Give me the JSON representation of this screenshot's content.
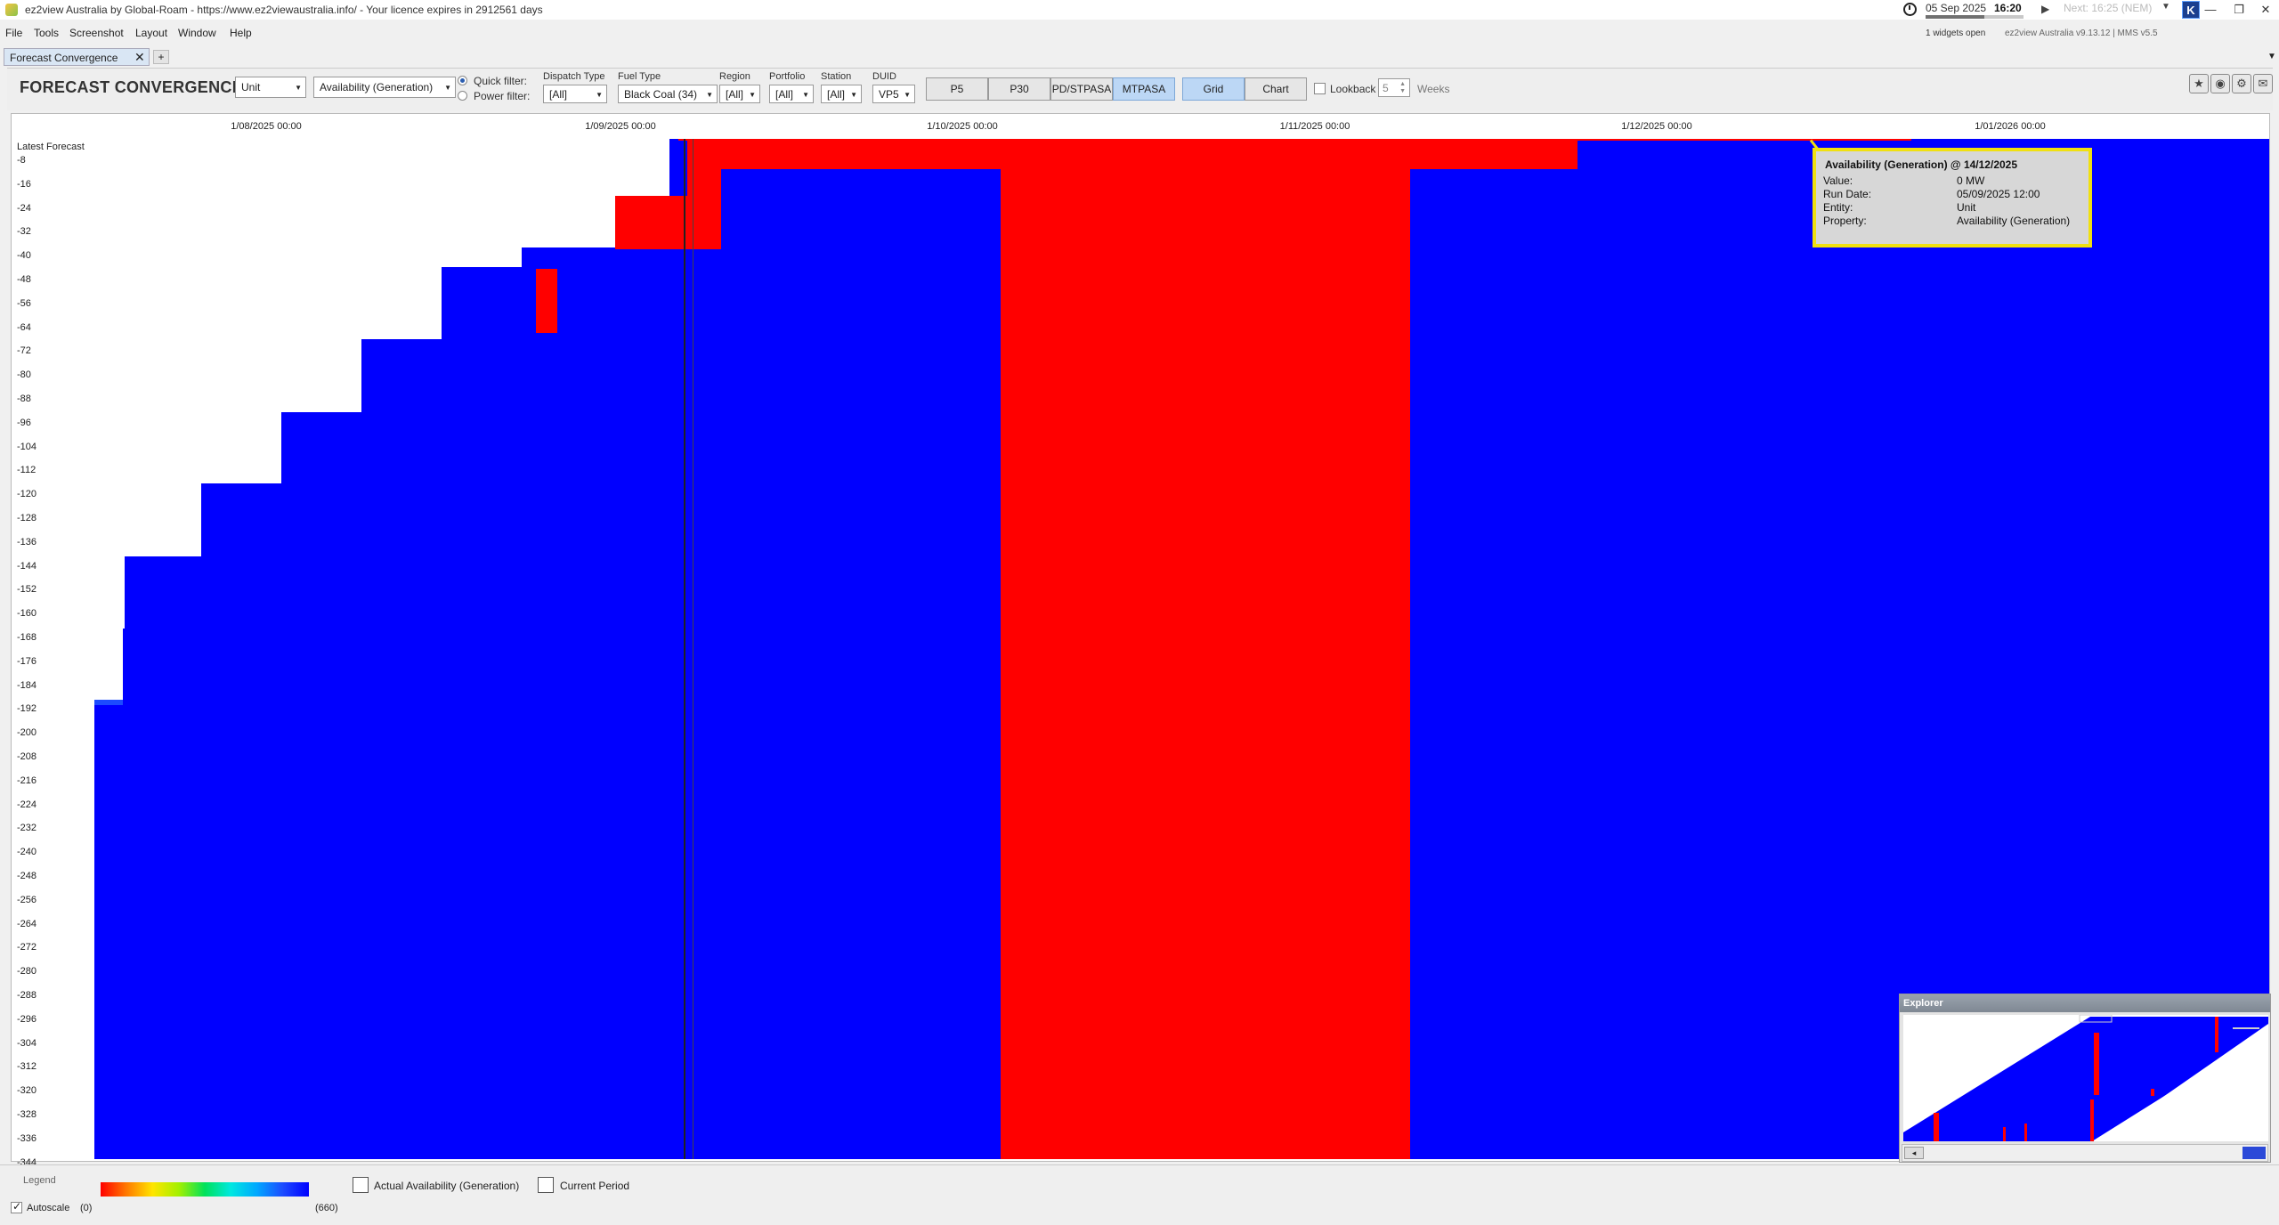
{
  "window": {
    "title": "ez2view Australia by Global-Roam - https://www.ez2viewaustralia.info/ - Your licence expires in 2912561 days",
    "date": "05 Sep 2025",
    "time": "16:20",
    "next": "Next: 16:25 (NEM)",
    "widgets_open": "1 widgets open",
    "version": "ez2view Australia v9.13.12 | MMS v5.5",
    "brand_letter": "K",
    "minimize": "—",
    "restore": "❐",
    "close": "✕",
    "progress": 0.6
  },
  "menu": [
    "File",
    "Tools",
    "Screenshot",
    "Layout",
    "Window",
    "Help"
  ],
  "tabs": {
    "active": "Forecast Convergence",
    "close": "✕",
    "add": "+",
    "overflow": "▼"
  },
  "toolbar": {
    "title": "FORECAST CONVERGENCE",
    "entity_type": "Unit",
    "property": "Availability (Generation)",
    "quick_filter": "Quick filter:",
    "power_filter": "Power filter:",
    "dispatch_type_label": "Dispatch Type",
    "dispatch_type": "[All]",
    "fuel_type_label": "Fuel Type",
    "fuel_type": "Black Coal (34)",
    "region_label": "Region",
    "region": "[All]",
    "portfolio_label": "Portfolio",
    "portfolio": "[All]",
    "station_label": "Station",
    "station": "[All]",
    "duid_label": "DUID",
    "duid": "VP5",
    "time_scales": [
      "P5",
      "P30",
      "PD/STPASA",
      "MTPASA"
    ],
    "time_scale_selected": "MTPASA",
    "views": [
      "Grid",
      "Chart"
    ],
    "view_selected": "Grid",
    "lookback_label": "Lookback",
    "lookback_value": "5",
    "weeks_label": "Weeks",
    "icons": [
      "star-icon",
      "camera-icon",
      "gear-icon",
      "comment-icon"
    ]
  },
  "grid": {
    "latest_forecast_label": "Latest Forecast",
    "date_labels": [
      "1/08/2025 00:00",
      "1/09/2025 00:00",
      "1/10/2025 00:00",
      "1/11/2025 00:00",
      "1/12/2025 00:00",
      "1/01/2026 00:00"
    ],
    "row_labels": [
      "-8",
      "-16",
      "-24",
      "-32",
      "-40",
      "-48",
      "-56",
      "-64",
      "-72",
      "-80",
      "-88",
      "-96",
      "-104",
      "-112",
      "-120",
      "-128",
      "-136",
      "-144",
      "-152",
      "-160",
      "-168",
      "-176",
      "-184",
      "-192",
      "-200",
      "-208",
      "-216",
      "-224",
      "-232",
      "-240",
      "-248",
      "-256",
      "-264",
      "-272",
      "-280",
      "-288",
      "-296",
      "-304",
      "-312",
      "-320",
      "-328",
      "-336",
      "-344"
    ]
  },
  "tooltip": {
    "title": "Availability (Generation) @ 14/12/2025",
    "rows": [
      {
        "key": "Value:",
        "value": "0 MW"
      },
      {
        "key": "Run Date:",
        "value": "05/09/2025 12:00"
      },
      {
        "key": "Entity:",
        "value": "Unit"
      },
      {
        "key": "Property:",
        "value": "Availability (Generation)"
      }
    ]
  },
  "explorer": {
    "title": "Explorer"
  },
  "legend": {
    "title": "Legend",
    "autoscale": "Autoscale",
    "min": "(0)",
    "max": "(660)",
    "actual": "Actual Availability (Generation)",
    "current_period": "Current Period"
  },
  "colors": {
    "available": "#0000ff",
    "unavailable": "#ff0000",
    "empty": "#ffffff",
    "tooltip_border": "#f0e010"
  }
}
